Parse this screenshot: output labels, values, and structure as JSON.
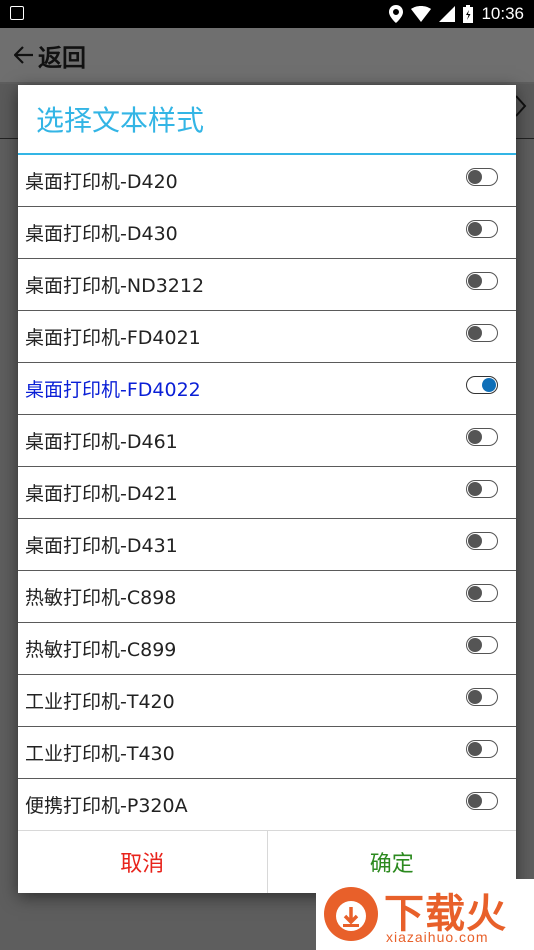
{
  "status_bar": {
    "time": "10:36",
    "icons": [
      "location-icon",
      "wifi-icon",
      "signal-icon",
      "battery-icon"
    ]
  },
  "app_bar": {
    "back_label": "返回"
  },
  "dialog": {
    "title": "选择文本样式",
    "items": [
      {
        "label": "桌面打印机-D420",
        "selected": false
      },
      {
        "label": "桌面打印机-D430",
        "selected": false
      },
      {
        "label": "桌面打印机-ND3212",
        "selected": false
      },
      {
        "label": "桌面打印机-FD4021",
        "selected": false
      },
      {
        "label": "桌面打印机-FD4022",
        "selected": true
      },
      {
        "label": "桌面打印机-D461",
        "selected": false
      },
      {
        "label": "桌面打印机-D421",
        "selected": false
      },
      {
        "label": "桌面打印机-D431",
        "selected": false
      },
      {
        "label": "热敏打印机-C898",
        "selected": false
      },
      {
        "label": "热敏打印机-C899",
        "selected": false
      },
      {
        "label": "工业打印机-T420",
        "selected": false
      },
      {
        "label": "工业打印机-T430",
        "selected": false
      },
      {
        "label": "便携打印机-P320A",
        "selected": false
      }
    ],
    "cancel_label": "取消",
    "ok_label": "确定"
  },
  "watermark": {
    "brand": "下载火",
    "url": "xiazaihuo.com"
  },
  "colors": {
    "title": "#33b5e5",
    "selected_text": "#0a1fd6",
    "toggle_on": "#0f6fb8",
    "cancel": "#e8231b",
    "ok": "#2c8a1f",
    "watermark": "#e8602a"
  }
}
